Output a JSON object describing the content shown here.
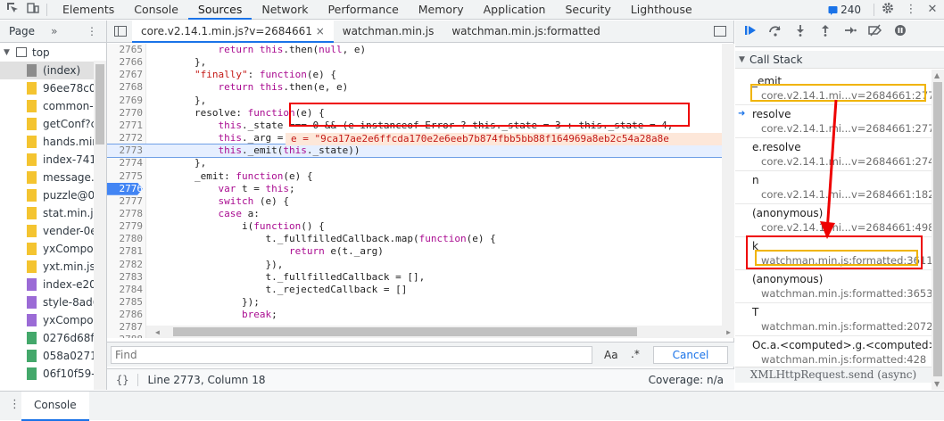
{
  "toolbar": {
    "tabs": [
      "Elements",
      "Console",
      "Sources",
      "Network",
      "Performance",
      "Memory",
      "Application",
      "Security",
      "Lighthouse"
    ],
    "issues_count": "240"
  },
  "navigator": {
    "tab_label": "Page",
    "more": "»",
    "items": [
      {
        "label": "top",
        "type": "frame"
      },
      {
        "label": "(index)",
        "type": "doc"
      },
      {
        "label": "96ee78c0c",
        "type": "js"
      },
      {
        "label": "common-a",
        "type": "js"
      },
      {
        "label": "getConf?c",
        "type": "js"
      },
      {
        "label": "hands.min",
        "type": "js"
      },
      {
        "label": "index-741",
        "type": "js"
      },
      {
        "label": "message.js",
        "type": "js"
      },
      {
        "label": "puzzle@0(",
        "type": "js"
      },
      {
        "label": "stat.min.js",
        "type": "js"
      },
      {
        "label": "vender-0e",
        "type": "js"
      },
      {
        "label": "yxCompor",
        "type": "js"
      },
      {
        "label": "yxt.min.js?",
        "type": "js"
      },
      {
        "label": "index-e20",
        "type": "css"
      },
      {
        "label": "style-8ad6",
        "type": "css"
      },
      {
        "label": "yxCompor",
        "type": "css"
      },
      {
        "label": "0276d68f4",
        "type": "img"
      },
      {
        "label": "058a0271",
        "type": "img"
      },
      {
        "label": "06f10f59-l",
        "type": "img"
      }
    ]
  },
  "editor": {
    "file_tabs": [
      {
        "label": "core.v2.14.1.min.js?v=2684661",
        "active": true
      },
      {
        "label": "watchman.min.js",
        "active": false
      },
      {
        "label": "watchman.min.js:formatted",
        "active": false
      }
    ],
    "lines": [
      {
        "n": "2765",
        "segs": [
          [
            "            ",
            ""
          ],
          [
            "return ",
            "kw"
          ],
          [
            "this",
            "kw"
          ],
          [
            ".then(",
            ""
          ],
          [
            "null",
            "kw"
          ],
          [
            ", e)",
            ""
          ]
        ]
      },
      {
        "n": "2766",
        "segs": [
          [
            "        },",
            ""
          ]
        ]
      },
      {
        "n": "2767",
        "segs": [
          [
            "        ",
            ""
          ],
          [
            "\"finally\"",
            "str"
          ],
          [
            ": ",
            ""
          ],
          [
            "function",
            "kw"
          ],
          [
            "(e) {",
            ""
          ]
        ]
      },
      {
        "n": "2768",
        "segs": [
          [
            "            ",
            ""
          ],
          [
            "return ",
            "kw"
          ],
          [
            "this",
            "kw"
          ],
          [
            ".then(e, e)",
            ""
          ]
        ]
      },
      {
        "n": "2769",
        "segs": [
          [
            "        },",
            ""
          ]
        ]
      },
      {
        "n": "2770",
        "segs": [
          [
            "        resolve: ",
            ""
          ],
          [
            "function",
            "kw"
          ],
          [
            "(e) {",
            ""
          ]
        ]
      },
      {
        "n": "2771",
        "segs": [
          [
            "            ",
            ""
          ],
          [
            "this",
            "kw"
          ],
          [
            "._state === 0 && (e instanceof Error ? this._state = 3 : this._state = 4,",
            ""
          ]
        ]
      },
      {
        "n": "2772",
        "segs": [
          [
            "            ",
            ""
          ],
          [
            "this",
            "kw"
          ],
          [
            "._arg = e,",
            ""
          ]
        ]
      },
      {
        "n": "2773",
        "segs": [
          [
            "            ",
            ""
          ],
          [
            "this",
            "kw"
          ],
          [
            "._emit(",
            ""
          ],
          [
            "this",
            "kw"
          ],
          [
            "._state))",
            ""
          ]
        ]
      },
      {
        "n": "2774",
        "segs": [
          [
            "        },",
            ""
          ]
        ]
      },
      {
        "n": "2775",
        "segs": [
          [
            "        _emit: ",
            ""
          ],
          [
            "function",
            "kw"
          ],
          [
            "(e) {",
            ""
          ]
        ]
      },
      {
        "n": "2776",
        "segs": [
          [
            "            ",
            ""
          ],
          [
            "var ",
            "kw"
          ],
          [
            "t = ",
            ""
          ],
          [
            "this",
            "kw"
          ],
          [
            ";",
            ""
          ]
        ]
      },
      {
        "n": "2777",
        "segs": [
          [
            "            ",
            ""
          ],
          [
            "switch ",
            "kw"
          ],
          [
            "(e) {",
            ""
          ]
        ]
      },
      {
        "n": "2778",
        "segs": [
          [
            "            ",
            ""
          ],
          [
            "case ",
            "kw"
          ],
          [
            "a:",
            ""
          ]
        ]
      },
      {
        "n": "2779",
        "segs": [
          [
            "                i(",
            ""
          ],
          [
            "function",
            "kw"
          ],
          [
            "() {",
            ""
          ]
        ]
      },
      {
        "n": "2780",
        "segs": [
          [
            "                    t._fullfilledCallback.map(",
            ""
          ],
          [
            "function",
            "kw"
          ],
          [
            "(e) {",
            ""
          ]
        ]
      },
      {
        "n": "2781",
        "segs": [
          [
            "                        ",
            ""
          ],
          [
            "return ",
            "kw"
          ],
          [
            "e(t._arg)",
            ""
          ]
        ]
      },
      {
        "n": "2782",
        "segs": [
          [
            "                    }),",
            ""
          ]
        ]
      },
      {
        "n": "2783",
        "segs": [
          [
            "                    t._fullfilledCallback = [],",
            ""
          ]
        ]
      },
      {
        "n": "2784",
        "segs": [
          [
            "                    t._rejectedCallback = []",
            ""
          ]
        ]
      },
      {
        "n": "2785",
        "segs": [
          [
            "                });",
            ""
          ]
        ]
      },
      {
        "n": "2786",
        "segs": [
          [
            "                ",
            ""
          ],
          [
            "break",
            "kw"
          ],
          [
            ";",
            ""
          ]
        ]
      },
      {
        "n": "2787",
        "segs": [
          [
            "",
            ""
          ]
        ]
      },
      {
        "n": "2788",
        "segs": [
          [
            "",
            ""
          ]
        ]
      }
    ],
    "inline_value": "e = \"9ca17ae2e6ffcda170e2e6eeb7b874fbb5bb88f164969a8eb2c54a28a8e",
    "find_placeholder": "Find",
    "find_case": "Aa",
    "find_regex": ".*",
    "find_cancel": "Cancel",
    "status_braces": "{}",
    "status_position": "Line 2773, Column 18",
    "status_coverage": "Coverage: n/a"
  },
  "debugger": {
    "call_stack_title": "Call Stack",
    "frames": [
      {
        "name": "_emit",
        "loc": "core.v2.14.1.mi...v=2684661:2776",
        "current": false
      },
      {
        "name": "resolve",
        "loc": "core.v2.14.1.mi...v=2684661:2773",
        "current": true
      },
      {
        "name": "e.resolve",
        "loc": "core.v2.14.1.mi...v=2684661:2747",
        "current": false
      },
      {
        "name": "n",
        "loc": "core.v2.14.1.mi...v=2684661:1828",
        "current": false
      },
      {
        "name": "(anonymous)",
        "loc": "core.v2.14.1.mi...v=2684661:4984",
        "current": false
      },
      {
        "name": "k",
        "loc": "watchman.min.js:formatted:3611",
        "current": false
      },
      {
        "name": "(anonymous)",
        "loc": "watchman.min.js:formatted:3653",
        "current": false
      },
      {
        "name": "T",
        "loc": "watchman.min.js:formatted:2072",
        "current": false
      },
      {
        "name": "Oc.a.<computed>.g.<computed>",
        "loc": "watchman.min.js:formatted:428",
        "current": false
      }
    ],
    "async_label": "XMLHttpRequest.send (async)"
  },
  "drawer": {
    "tab_label": "Console"
  },
  "colors": {
    "accent": "#1a73e8",
    "annotation_red": "#ee0000",
    "annotation_gold": "#f0b400"
  }
}
